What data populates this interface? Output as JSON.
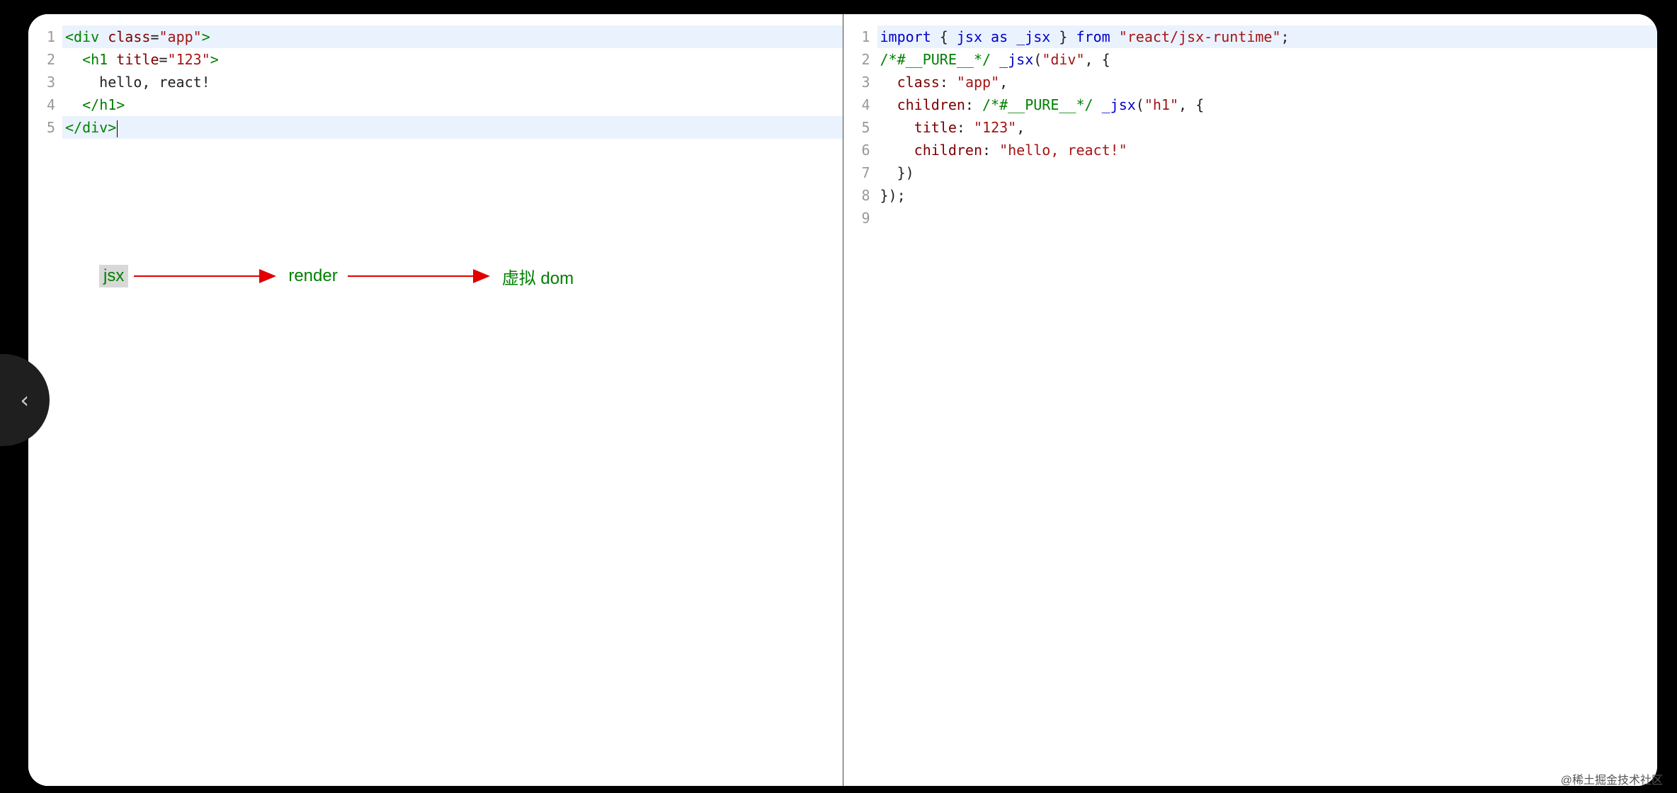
{
  "left_editor": {
    "line_numbers": [
      "1",
      "2",
      "3",
      "4",
      "5"
    ],
    "lines": [
      [
        {
          "t": "<",
          "c": "tok-tag"
        },
        {
          "t": "div",
          "c": "tok-tag"
        },
        {
          "t": " ",
          "c": "tok-plain"
        },
        {
          "t": "class",
          "c": "tok-attr"
        },
        {
          "t": "=",
          "c": "tok-punc"
        },
        {
          "t": "\"app\"",
          "c": "tok-string"
        },
        {
          "t": ">",
          "c": "tok-tag"
        }
      ],
      [
        {
          "t": "  ",
          "c": "tok-plain"
        },
        {
          "t": "<",
          "c": "tok-tag"
        },
        {
          "t": "h1",
          "c": "tok-tag"
        },
        {
          "t": " ",
          "c": "tok-plain"
        },
        {
          "t": "title",
          "c": "tok-attr"
        },
        {
          "t": "=",
          "c": "tok-punc"
        },
        {
          "t": "\"123\"",
          "c": "tok-string"
        },
        {
          "t": ">",
          "c": "tok-tag"
        }
      ],
      [
        {
          "t": "    hello, react!",
          "c": "tok-plain"
        }
      ],
      [
        {
          "t": "  ",
          "c": "tok-plain"
        },
        {
          "t": "</",
          "c": "tok-tag"
        },
        {
          "t": "h1",
          "c": "tok-tag"
        },
        {
          "t": ">",
          "c": "tok-tag"
        }
      ],
      [
        {
          "t": "</",
          "c": "tok-tag"
        },
        {
          "t": "div",
          "c": "tok-tag"
        },
        {
          "t": ">",
          "c": "tok-tag"
        }
      ]
    ],
    "active_line_index": 4
  },
  "right_editor": {
    "line_numbers": [
      "1",
      "2",
      "3",
      "4",
      "5",
      "6",
      "7",
      "8",
      "9"
    ],
    "lines": [
      [
        {
          "t": "import",
          "c": "tok-keyword"
        },
        {
          "t": " { ",
          "c": "tok-punc"
        },
        {
          "t": "jsx",
          "c": "tok-func"
        },
        {
          "t": " ",
          "c": "tok-plain"
        },
        {
          "t": "as",
          "c": "tok-keyword"
        },
        {
          "t": " ",
          "c": "tok-plain"
        },
        {
          "t": "_jsx",
          "c": "tok-func"
        },
        {
          "t": " } ",
          "c": "tok-punc"
        },
        {
          "t": "from",
          "c": "tok-keyword"
        },
        {
          "t": " ",
          "c": "tok-plain"
        },
        {
          "t": "\"react/jsx-runtime\"",
          "c": "tok-string"
        },
        {
          "t": ";",
          "c": "tok-punc"
        }
      ],
      [
        {
          "t": "/*#__PURE__*/",
          "c": "tok-comment"
        },
        {
          "t": " ",
          "c": "tok-plain"
        },
        {
          "t": "_jsx",
          "c": "tok-func"
        },
        {
          "t": "(",
          "c": "tok-punc"
        },
        {
          "t": "\"div\"",
          "c": "tok-string"
        },
        {
          "t": ", {",
          "c": "tok-punc"
        }
      ],
      [
        {
          "t": "  ",
          "c": "tok-plain"
        },
        {
          "t": "class",
          "c": "tok-prop"
        },
        {
          "t": ": ",
          "c": "tok-punc"
        },
        {
          "t": "\"app\"",
          "c": "tok-string"
        },
        {
          "t": ",",
          "c": "tok-punc"
        }
      ],
      [
        {
          "t": "  ",
          "c": "tok-plain"
        },
        {
          "t": "children",
          "c": "tok-prop"
        },
        {
          "t": ": ",
          "c": "tok-punc"
        },
        {
          "t": "/*#__PURE__*/",
          "c": "tok-comment"
        },
        {
          "t": " ",
          "c": "tok-plain"
        },
        {
          "t": "_jsx",
          "c": "tok-func"
        },
        {
          "t": "(",
          "c": "tok-punc"
        },
        {
          "t": "\"h1\"",
          "c": "tok-string"
        },
        {
          "t": ", {",
          "c": "tok-punc"
        }
      ],
      [
        {
          "t": "    ",
          "c": "tok-plain"
        },
        {
          "t": "title",
          "c": "tok-prop"
        },
        {
          "t": ": ",
          "c": "tok-punc"
        },
        {
          "t": "\"123\"",
          "c": "tok-string"
        },
        {
          "t": ",",
          "c": "tok-punc"
        }
      ],
      [
        {
          "t": "    ",
          "c": "tok-plain"
        },
        {
          "t": "children",
          "c": "tok-prop"
        },
        {
          "t": ": ",
          "c": "tok-punc"
        },
        {
          "t": "\"hello, react!\"",
          "c": "tok-string"
        }
      ],
      [
        {
          "t": "  })",
          "c": "tok-punc"
        }
      ],
      [
        {
          "t": "});",
          "c": "tok-punc"
        }
      ],
      [
        {
          "t": "",
          "c": "tok-plain"
        }
      ]
    ],
    "active_line_index": 0
  },
  "diagram": {
    "label1": "jsx",
    "label2": "render",
    "label3": "虚拟 dom"
  },
  "side_tab_glyph": "‹",
  "watermark": "@稀土掘金技术社区"
}
